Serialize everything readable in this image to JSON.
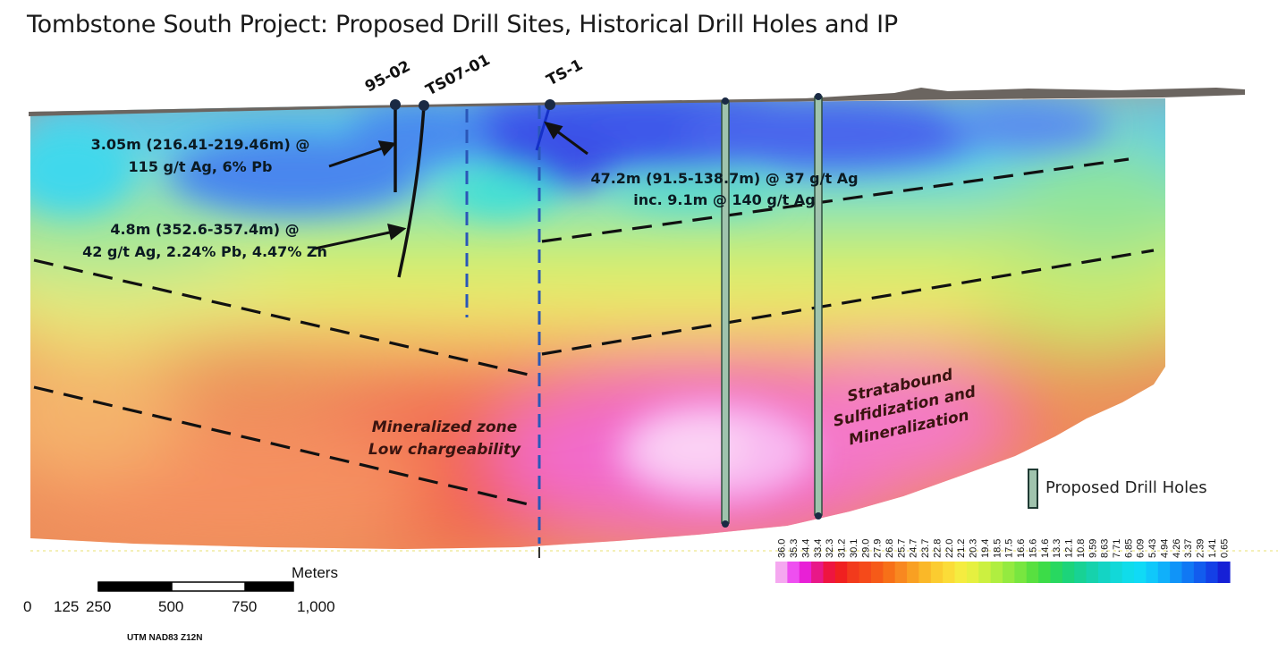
{
  "title": "Tombstone South Project: Proposed Drill Sites, Historical Drill Holes and IP",
  "drill_holes": {
    "h1": "95-02",
    "h2": "TS07-01",
    "h3": "TS-1"
  },
  "annotations": {
    "a1_line1": "3.05m (216.41-219.46m) @",
    "a1_line2": "115 g/t Ag, 6% Pb",
    "a2_line1": "4.8m (352.6-357.4m) @",
    "a2_line2": "42 g/t Ag, 2.24% Pb, 4.47% Zn",
    "a3_line1": "47.2m (91.5-138.7m) @ 37 g/t Ag",
    "a3_line2": "inc. 9.1m @ 140 g/t Ag"
  },
  "zones": {
    "mineralized_line1": "Mineralized zone",
    "mineralized_line2": "Low chargeability",
    "strata_line1": "Stratabound",
    "strata_line2": "Sulfidization and",
    "strata_line3": "Mineralization"
  },
  "legend": {
    "label": "Proposed Drill Holes"
  },
  "scale": {
    "unit": "Meters",
    "ticks": [
      "0",
      "125",
      "250",
      "500",
      "750",
      "1,000"
    ],
    "projection": "UTM NAD83 Z12N"
  },
  "colorbar": {
    "values": [
      "36.0",
      "35.3",
      "34.4",
      "33.4",
      "32.3",
      "31.2",
      "30.1",
      "29.0",
      "27.9",
      "26.8",
      "25.7",
      "24.7",
      "23.7",
      "22.8",
      "22.0",
      "21.2",
      "20.3",
      "19.4",
      "18.5",
      "17.5",
      "16.6",
      "15.6",
      "14.6",
      "13.3",
      "12.1",
      "10.8",
      "9.59",
      "8.63",
      "7.71",
      "6.85",
      "6.09",
      "5.43",
      "4.94",
      "4.26",
      "3.37",
      "2.39",
      "1.41",
      "0.65"
    ],
    "colors": [
      "#f5a8f0",
      "#ee4ff0",
      "#e820d6",
      "#e81888",
      "#ee1540",
      "#f02020",
      "#f23a1c",
      "#f54a1a",
      "#f65a18",
      "#f77018",
      "#f88820",
      "#f9a022",
      "#fab828",
      "#fbcc30",
      "#fbdc38",
      "#f5ec40",
      "#e6f040",
      "#ccf040",
      "#b0ee40",
      "#94ea40",
      "#78e640",
      "#58e040",
      "#3cdc48",
      "#28d860",
      "#1cd47a",
      "#18d294",
      "#16d2ac",
      "#14d4c4",
      "#12d8d8",
      "#10dcea",
      "#10daf6",
      "#10c8fa",
      "#10b0fa",
      "#1094f8",
      "#1078f4",
      "#125cee",
      "#1440e6",
      "#1620d6"
    ]
  },
  "colors": {
    "drill_hole_fill": "#9fc3ad",
    "historic_hole": "#1a2a44",
    "dashed_blue": "#2a57b8",
    "fault_line": "#111111"
  }
}
